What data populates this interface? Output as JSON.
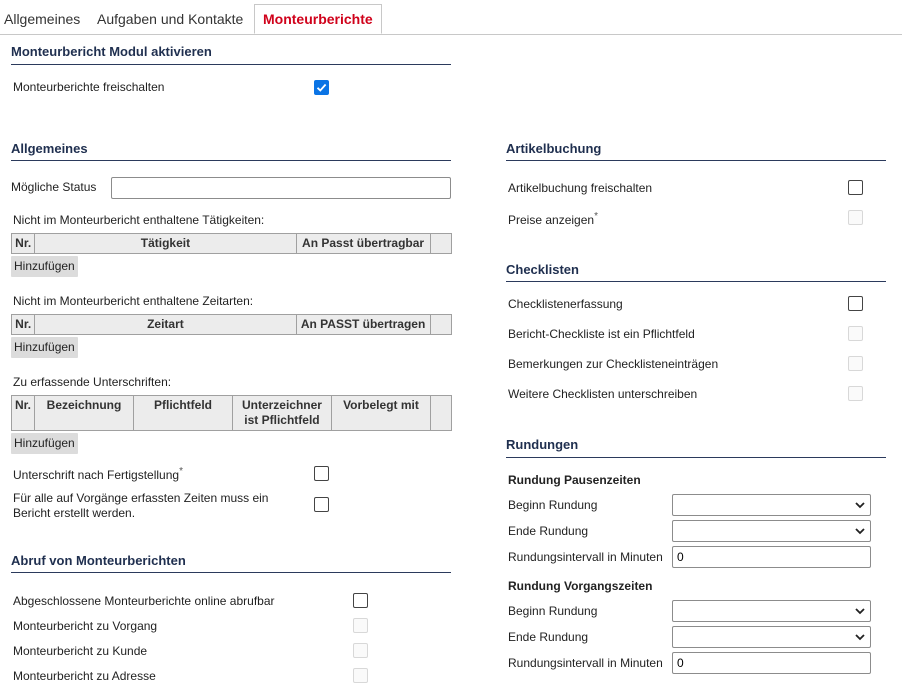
{
  "tabs": [
    "Allgemeines",
    "Aufgaben und Kontakte",
    "Monteurberichte"
  ],
  "modul": {
    "title": "Monteurbericht Modul aktivieren",
    "freischalten_label": "Monteurberichte freischalten",
    "freischalten_checked": true
  },
  "allgemeines": {
    "title": "Allgemeines",
    "status_label": "Mögliche Status",
    "status_value": "",
    "taetigkeiten_label": "Nicht im Monteurbericht enthaltene Tätigkeiten:",
    "taetigkeiten_headers": [
      "Nr.",
      "Tätigkeit",
      "An Passt übertragbar",
      ""
    ],
    "zeitarten_label": "Nicht im Monteurbericht enthaltene Zeitarten:",
    "zeitarten_headers": [
      "Nr.",
      "Zeitart",
      "An PASST übertragen",
      ""
    ],
    "unterschriften_label": "Zu erfassende Unterschriften:",
    "unterschriften_headers": [
      "Nr.",
      "Bezeichnung",
      "Pflichtfeld",
      "Unterzeichner ist Pflichtfeld",
      "Vorbelegt mit",
      ""
    ],
    "add_label": "Hinzufügen",
    "unterschrift_fertig_label": "Unterschrift nach Fertigstellung",
    "required_mark": "*",
    "zeiten_bericht_label": "Für alle auf Vorgänge erfassten Zeiten muss ein Bericht erstellt werden."
  },
  "abruf": {
    "title": "Abruf von Monteurberichten",
    "items": [
      {
        "label": "Abgeschlossene Monteurberichte online abrufbar",
        "enabled": true
      },
      {
        "label": "Monteurbericht zu Vorgang",
        "enabled": false
      },
      {
        "label": "Monteurbericht zu Kunde",
        "enabled": false
      },
      {
        "label": "Monteurbericht zu Adresse",
        "enabled": false
      }
    ]
  },
  "artikel": {
    "title": "Artikelbuchung",
    "freischalten_label": "Artikelbuchung freischalten",
    "preise_label": "Preise anzeigen",
    "required_mark": "*"
  },
  "checklisten": {
    "title": "Checklisten",
    "items": [
      {
        "label": "Checklistenerfassung",
        "enabled": true
      },
      {
        "label": "Bericht-Checkliste ist ein Pflichtfeld",
        "enabled": false
      },
      {
        "label": "Bemerkungen zur Checklisteneinträgen",
        "enabled": false
      },
      {
        "label": "Weitere Checklisten unterschreiben",
        "enabled": false
      }
    ]
  },
  "rundungen": {
    "title": "Rundungen",
    "pausen": {
      "title": "Rundung Pausenzeiten",
      "beginn_label": "Beginn Rundung",
      "beginn_value": "",
      "ende_label": "Ende Rundung",
      "ende_value": "",
      "intervall_label": "Rundungsintervall in Minuten",
      "intervall_value": "0"
    },
    "vorgang": {
      "title": "Rundung Vorgangszeiten",
      "beginn_label": "Beginn Rundung",
      "beginn_value": "",
      "ende_label": "Ende Rundung",
      "ende_value": "",
      "intervall_label": "Rundungsintervall in Minuten",
      "intervall_value": "0"
    }
  },
  "colors": {
    "accent_tab": "#d0021b",
    "checkbox_checked": "#0b74e5",
    "heading": "#1f2f4f"
  }
}
